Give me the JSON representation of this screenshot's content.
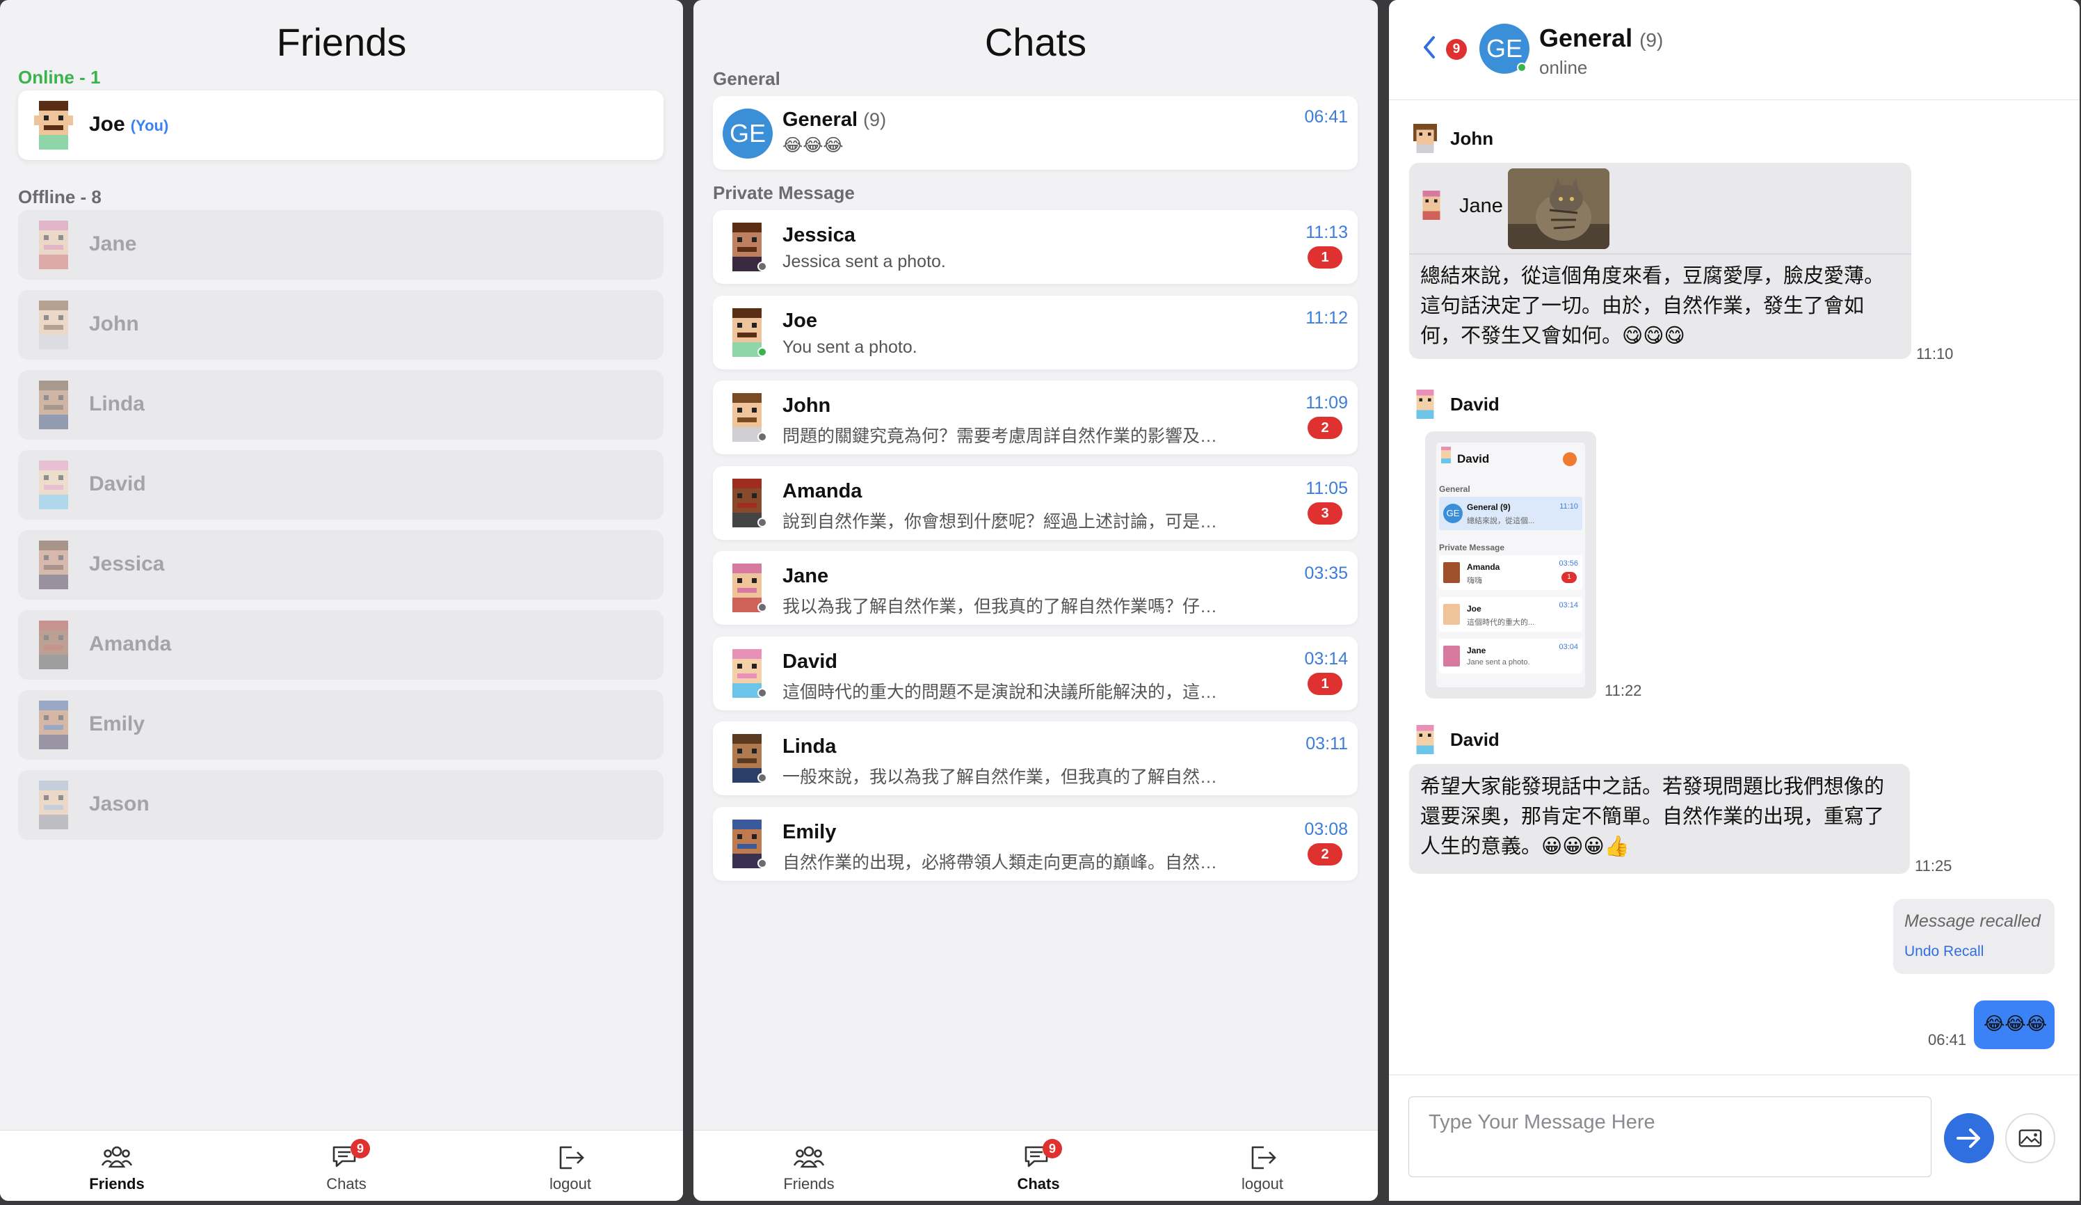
{
  "friends_panel": {
    "title": "Friends",
    "online_header": "Online - 1",
    "offline_header": "Offline - 8",
    "online": [
      {
        "name": "Joe",
        "you_tag": "(You)"
      }
    ],
    "offline": [
      {
        "name": "Jane"
      },
      {
        "name": "John"
      },
      {
        "name": "Linda"
      },
      {
        "name": "David"
      },
      {
        "name": "Jessica"
      },
      {
        "name": "Amanda"
      },
      {
        "name": "Emily"
      },
      {
        "name": "Jason"
      }
    ]
  },
  "chats_panel": {
    "title": "Chats",
    "general_header": "General",
    "private_header": "Private Message",
    "general": {
      "avatar": "GE",
      "name": "General",
      "count": "(9)",
      "preview": "😂😂😂",
      "time": "06:41"
    },
    "private": [
      {
        "name": "Jessica",
        "preview": "Jessica sent a photo.",
        "time": "11:13",
        "badge": "1",
        "status": "offline"
      },
      {
        "name": "Joe",
        "preview": "You sent a photo.",
        "time": "11:12",
        "badge": "",
        "status": "online"
      },
      {
        "name": "John",
        "preview": "問題的關鍵究竟為何？需要考慮周詳自然作業的影響及…",
        "time": "11:09",
        "badge": "2",
        "status": "offline"
      },
      {
        "name": "Amanda",
        "preview": "說到自然作業，你會想到什麼呢？經過上述討論，可是…",
        "time": "11:05",
        "badge": "3",
        "status": "offline"
      },
      {
        "name": "Jane",
        "preview": "我以為我了解自然作業，但我真的了解自然作業嗎？仔…",
        "time": "03:35",
        "badge": "",
        "status": "offline"
      },
      {
        "name": "David",
        "preview": "這個時代的重大的問題不是演說和決議所能解決的，這…",
        "time": "03:14",
        "badge": "1",
        "status": "offline"
      },
      {
        "name": "Linda",
        "preview": "一般來說，我以為我了解自然作業，但我真的了解自然…",
        "time": "03:11",
        "badge": "",
        "status": "offline"
      },
      {
        "name": "Emily",
        "preview": "自然作業的出現，必將帶領人類走向更高的巔峰。自然…",
        "time": "03:08",
        "badge": "2",
        "status": "offline"
      }
    ]
  },
  "tabbar": {
    "friends": "Friends",
    "chats": "Chats",
    "chats_badge": "9",
    "logout": "logout"
  },
  "room": {
    "back_badge": "9",
    "avatar": "GE",
    "title": "General",
    "count": "(9)",
    "status": "online",
    "messages": {
      "m1_sender": "John",
      "m1_reply_name": "Jane",
      "m1_text": "總結來說，從這個角度來看，豆腐愛厚，臉皮愛薄。這句話決定了一切。由於，自然作業，發生了會如何，不發生又會如何。😋😋😋",
      "m1_time": "11:10",
      "m2_sender": "David",
      "m2_time": "11:22",
      "m3_sender": "David",
      "m3_text": "希望大家能發現話中之話。若發現問題比我們想像的還要深奧，那肯定不簡單。自然作業的出現，重寫了人生的意義。😀😀😀👍",
      "m3_time": "11:25",
      "recalled": "Message recalled",
      "undo": "Undo Recall",
      "m4_text": "😂😂😂",
      "m4_time": "06:41"
    },
    "thumb": {
      "user": "David",
      "general_label": "General",
      "general_name": "General (9)",
      "general_time": "11:10",
      "general_preview": "總結來說，從這個...",
      "private_label": "Private Message",
      "r1_name": "Amanda",
      "r1_time": "03:56",
      "r1_preview": "嗨嗨",
      "r1_badge": "1",
      "r2_name": "Joe",
      "r2_time": "03:14",
      "r2_preview": "這個時代的重大的...",
      "r3_name": "Jane",
      "r3_time": "03:04",
      "r3_preview": "Jane sent a photo."
    },
    "input_placeholder": "Type Your Message Here"
  },
  "colors": {
    "accent": "#3b82f6",
    "badge": "#e03131",
    "online": "#38b44a"
  }
}
